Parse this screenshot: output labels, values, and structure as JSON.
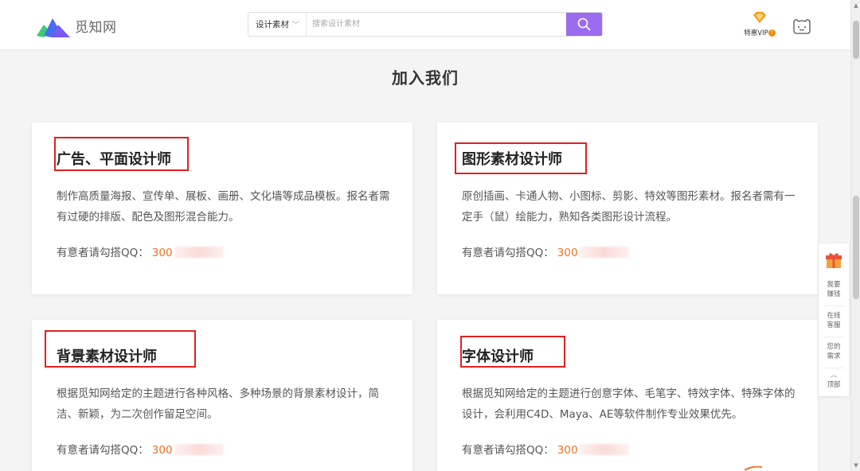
{
  "header": {
    "logo_text": "觅知网",
    "search": {
      "category": "设计素材",
      "placeholder": "搜索设计素材"
    },
    "vip": {
      "label": "特惠VIP",
      "badge": "!"
    }
  },
  "page_title": "加入我们",
  "cards": [
    {
      "title": "广告、平面设计师",
      "desc": "制作高质量海报、宣传单、展板、画册、文化墙等成品模板。报名者需有过硬的排版、配色及图形混合能力。",
      "qq_label": "有意者请勾搭QQ：",
      "qq_prefix": "300"
    },
    {
      "title": "图形素材设计师",
      "desc": "原创插画、卡通人物、小图标、剪影、特效等图形素材。报名者需有一定手（鼠）绘能力，熟知各类图形设计流程。",
      "qq_label": "有意者请勾搭QQ：",
      "qq_prefix": "300"
    },
    {
      "title": "背景素材设计师",
      "desc": "根据觅知网给定的主题进行各种风格、多种场景的背景素材设计，简洁、新颖，为二次创作留足空间。",
      "qq_label": "有意者请勾搭QQ：",
      "qq_prefix": "300"
    },
    {
      "title": "字体设计师",
      "desc": "根据觅知网给定的主题进行创意字体、毛笔字、特效字体、特殊字体的设计，会利用C4D、Maya、AE等软件制作专业效果优先。",
      "qq_label": "有意者请勾搭QQ：",
      "qq_prefix": "300"
    }
  ],
  "float_bar": {
    "earn": [
      "我要",
      "赚钱"
    ],
    "service": [
      "在线",
      "客服"
    ],
    "request": [
      "您的",
      "需求"
    ],
    "top": "顶部"
  },
  "colors": {
    "accent": "#9b6cf0",
    "highlight_box": "#e02020",
    "qq_number": "#f07020",
    "vip_orange": "#f08a00"
  },
  "icons": {
    "logo": "mizhi-logo-icon",
    "search": "search-icon",
    "vip": "vip-diamond-icon",
    "user": "user-avatar-icon",
    "gift": "gift-icon",
    "top": "chevron-up-icon"
  }
}
